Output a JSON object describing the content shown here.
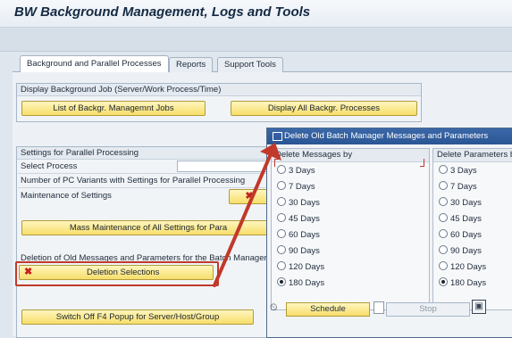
{
  "window": {
    "title": "BW Background Management, Logs and Tools"
  },
  "tabs": [
    {
      "label": "Background and Parallel Processes"
    },
    {
      "label": "Reports"
    },
    {
      "label": "Support Tools"
    }
  ],
  "display_background_job": {
    "title": "Display Background Job (Server/Work Process/Time)",
    "list_button": "List of Backgr. Managemnt Jobs",
    "display_all_button": "Display All Backgr. Processes"
  },
  "parallel_settings": {
    "title": "Settings for Parallel Processing",
    "select_process_label": "Select Process",
    "pc_variants_label": "Number of PC Variants with Settings for Parallel Processing",
    "maintenance_label": "Maintenance of Settings",
    "mass_maintenance_button": "Mass Maintenance of All Settings for Para",
    "deletion_label": "Deletion of Old Messages and Parameters for the Batch Manager",
    "deletion_button": "Deletion Selections",
    "switch_off_button": "Switch Off F4 Popup for Server/Host/Group"
  },
  "popup": {
    "title": "Delete Old Batch Manager Messages and Parameters",
    "messages_column": {
      "title": "Delete Messages by",
      "options": [
        "3 Days",
        "7 Days",
        "30 Days",
        "45 Days",
        "60 Days",
        "90 Days",
        "120 Days",
        "180 Days"
      ],
      "selected": "180 Days"
    },
    "parameters_column": {
      "title": "Delete Parameters by",
      "options": [
        "3 Days",
        "7 Days",
        "30 Days",
        "45 Days",
        "60 Days",
        "90 Days",
        "120 Days",
        "180 Days"
      ],
      "selected": "180 Days"
    },
    "schedule_button": "Schedule",
    "stop_button": "Stop"
  },
  "colors": {
    "annotation_red": "#c0392b",
    "popup_title_blue": "#2a5594",
    "button_yellow": "#f7de6a"
  }
}
